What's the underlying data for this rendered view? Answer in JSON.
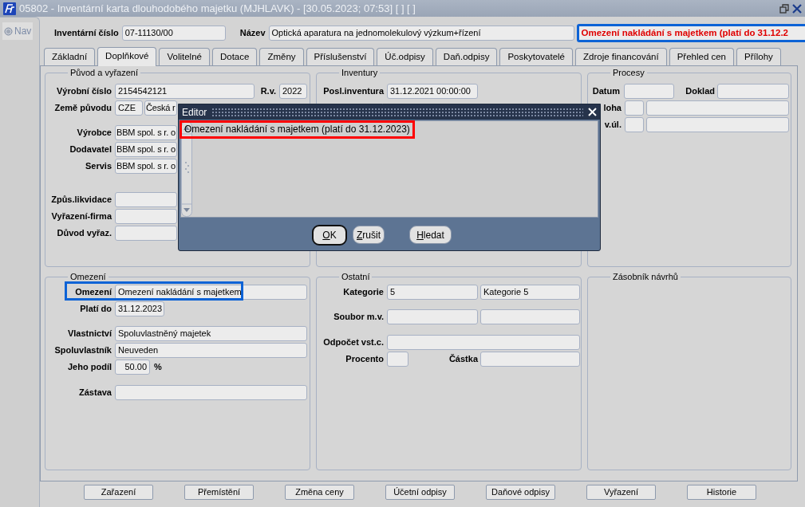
{
  "window": {
    "title": "05802 - Inventární karta dlouhodobého majetku (MJHLAVK) - [30.05.2023; 07:53]  [ ]  [ ]"
  },
  "nav": {
    "label": "Nav"
  },
  "header": {
    "inventory_number": {
      "label": "Inventární číslo",
      "value": "07-11130/00"
    },
    "name": {
      "label": "Název",
      "value": "Optická aparatura na jednomolekulový výzkum+řízení"
    },
    "restriction_notice": {
      "text": "Omezení nakládání s majetkem (platí do 31.12.2",
      "highlighted": true
    }
  },
  "tabs": [
    {
      "label": "Základní",
      "selected": false
    },
    {
      "label": "Doplňkové",
      "selected": true
    },
    {
      "label": "Volitelné",
      "selected": false
    },
    {
      "label": "Dotace",
      "selected": false
    },
    {
      "label": "Změny",
      "selected": false
    },
    {
      "label": "Příslušenství",
      "selected": false
    },
    {
      "label": "Úč.odpisy",
      "selected": false
    },
    {
      "label": "Daň.odpisy",
      "selected": false
    },
    {
      "label": "Poskytovatelé",
      "selected": false
    },
    {
      "label": "Zdroje financování",
      "selected": false
    },
    {
      "label": "Přehled cen",
      "selected": false
    },
    {
      "label": "Přílohy",
      "selected": false
    }
  ],
  "groups": [
    {
      "title": "Původ a vyřazení",
      "rows": [
        {
          "items": [
            {
              "kind": "label",
              "text": "Výrobní číslo"
            },
            {
              "kind": "field",
              "value": "2154542121"
            },
            {
              "kind": "label",
              "text": "R.v."
            },
            {
              "kind": "field",
              "value": "2022"
            }
          ]
        },
        {
          "items": [
            {
              "kind": "label",
              "text": "Země původu"
            },
            {
              "kind": "field",
              "value": "CZE"
            },
            {
              "kind": "field",
              "value": "Česká r"
            }
          ]
        },
        {
          "items": [
            {
              "kind": "label",
              "text": "Výrobce"
            },
            {
              "kind": "field",
              "value": "BBM spol. s r. o"
            }
          ]
        },
        {
          "items": [
            {
              "kind": "label",
              "text": "Dodavatel"
            },
            {
              "kind": "field",
              "value": "BBM spol. s r. o"
            }
          ]
        },
        {
          "items": [
            {
              "kind": "label",
              "text": "Servis"
            },
            {
              "kind": "field",
              "value": "BBM spol. s r. o"
            }
          ]
        },
        {
          "items": [
            {
              "kind": "label",
              "text": "Způs.likvidace"
            },
            {
              "kind": "empty"
            }
          ]
        },
        {
          "items": [
            {
              "kind": "label",
              "text": "Vyřazení-firma"
            },
            {
              "kind": "empty"
            }
          ]
        },
        {
          "items": [
            {
              "kind": "label",
              "text": "Důvod vyřaz."
            },
            {
              "kind": "empty"
            }
          ]
        }
      ]
    },
    {
      "title": "Inventury",
      "rows": [
        {
          "items": [
            {
              "kind": "label",
              "text": "Posl.inventura"
            },
            {
              "kind": "field",
              "value": "31.12.2021 00:00:00"
            }
          ]
        }
      ]
    },
    {
      "title": "Procesy",
      "rows": [
        {
          "items": [
            {
              "kind": "label",
              "text": "Datum"
            },
            {
              "kind": "empty"
            },
            {
              "kind": "label",
              "text": "Doklad"
            },
            {
              "kind": "empty"
            }
          ]
        },
        {
          "items": [
            {
              "kind": "label",
              "text": "loha"
            },
            {
              "kind": "empty"
            },
            {
              "kind": "empty"
            }
          ]
        },
        {
          "items": [
            {
              "kind": "label",
              "text": "v.úl."
            },
            {
              "kind": "empty"
            },
            {
              "kind": "empty"
            }
          ]
        }
      ]
    },
    {
      "title": "Omezení",
      "rows": [
        {
          "highlighted": true,
          "items": [
            {
              "kind": "label",
              "text": "Omezení"
            },
            {
              "kind": "field",
              "value": "Omezení nakládání s majetkem"
            }
          ]
        },
        {
          "highlighted": false,
          "items": [
            {
              "kind": "label",
              "text": "Platí do"
            },
            {
              "kind": "field",
              "value": "31.12.2023"
            }
          ]
        },
        {
          "highlighted": false,
          "items": [
            {
              "kind": "label",
              "text": "Vlastnictví"
            },
            {
              "kind": "field",
              "value": "Spoluvlastněný majetek"
            }
          ]
        },
        {
          "highlighted": false,
          "items": [
            {
              "kind": "label",
              "text": "Spoluvlastník"
            },
            {
              "kind": "field",
              "value": "Neuveden"
            }
          ]
        },
        {
          "highlighted": false,
          "items": [
            {
              "kind": "label",
              "text": "Jeho podíl"
            },
            {
              "kind": "field",
              "value": "50.00"
            },
            {
              "kind": "unit",
              "text": "%"
            }
          ]
        },
        {
          "highlighted": false,
          "items": [
            {
              "kind": "label",
              "text": "Zástava"
            },
            {
              "kind": "empty"
            }
          ]
        }
      ]
    },
    {
      "title": "Ostatní",
      "rows": [
        {
          "items": [
            {
              "kind": "label",
              "text": "Kategorie"
            },
            {
              "kind": "field",
              "value": "5"
            },
            {
              "kind": "field",
              "value": "Kategorie 5"
            }
          ]
        },
        {
          "items": [
            {
              "kind": "label",
              "text": "Soubor m.v."
            },
            {
              "kind": "empty"
            },
            {
              "kind": "empty"
            }
          ]
        },
        {
          "items": [
            {
              "kind": "label",
              "text": "Odpočet vst.c."
            },
            {
              "kind": "empty"
            }
          ]
        },
        {
          "items": [
            {
              "kind": "label",
              "text": "Procento"
            },
            {
              "kind": "empty"
            },
            {
              "kind": "label",
              "text": "Částka"
            },
            {
              "kind": "empty"
            }
          ]
        }
      ]
    },
    {
      "title": "Zásobník návrhů"
    }
  ],
  "buttons": [
    "Zařazení",
    "Přemístění",
    "Změna ceny",
    "Účetní odpisy",
    "Daňové odpisy",
    "Vyřazení",
    "Historie"
  ],
  "dialog": {
    "title": "Editor",
    "text": "Omezení nakládání s majetkem (platí do 31.12.2023)",
    "text_highlighted": true,
    "buttons": [
      {
        "label": "OK",
        "focused": true
      },
      {
        "label": "Zrušit",
        "focused": false
      },
      {
        "label": "Hledat",
        "focused": false
      }
    ]
  }
}
